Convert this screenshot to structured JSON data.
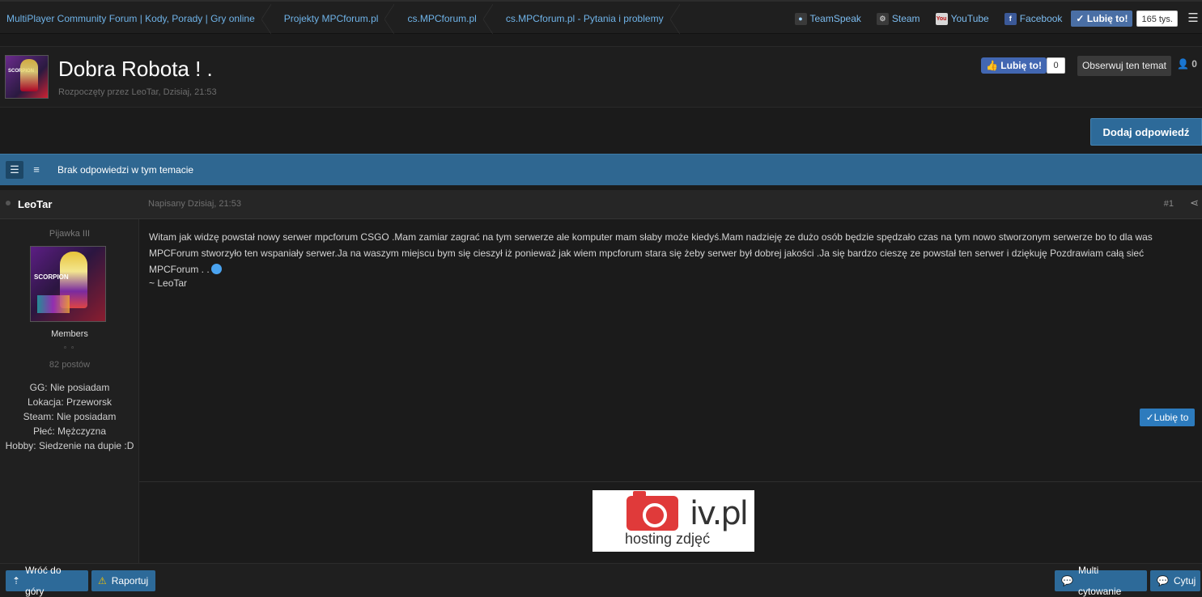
{
  "breadcrumb": [
    "MultiPlayer Community Forum | Kody, Porady | Gry online",
    "Projekty MPCforum.pl",
    "cs.MPCforum.pl",
    "cs.MPCforum.pl - Pytania i problemy"
  ],
  "social": {
    "teamspeak": "TeamSpeak",
    "steam": "Steam",
    "youtube": "YouTube",
    "facebook": "Facebook",
    "like_label": "Lubię to!",
    "like_count": "165 tys.",
    "icons": [
      "teamspeak-icon",
      "steam-icon",
      "youtube-icon",
      "facebook-icon",
      "menu-icon"
    ]
  },
  "topic": {
    "title": "Dobra Robota ! .",
    "meta": "Rozpoczęty przez LeoTar, Dzisiaj, 21:53",
    "fb_like": "Lubię to!",
    "fb_count": "0",
    "follow": "Obserwuj ten temat",
    "followers": "0"
  },
  "reply_button": "Dodaj odpowiedź",
  "infobar": {
    "text": "Brak odpowiedzi w tym temacie"
  },
  "post": {
    "author": "LeoTar",
    "date": "Napisany Dzisiaj, 21:53",
    "number": "#1",
    "rank": "Pijawka III",
    "avatar_text": "SCORPION",
    "group": "Members",
    "pips": "▫ ▫",
    "posts_count": "82 postów",
    "fields": [
      "GG: Nie posiadam",
      "Lokacja: Przeworsk",
      "Steam: Nie posiadam",
      "Płeć: Mężczyzna",
      "Hobby: Siedzenie na dupie :D"
    ],
    "body": "Witam jak widzę powstał nowy serwer mpcforum CSGO .Mam zamiar zagrać na tym serwerze ale komputer mam słaby może kiedyś.Mam nadzieję ze dużo osób będzie spędzało czas na tym nowo stworzonym serwerze bo to dla was MPCForum stworzyło ten wspaniały serwer.Ja na waszym miejscu bym się cieszył iż ponieważ jak wiem mpcforum stara się żeby serwer był dobrej jakości .Ja się bardzo cieszę ze powstał ten serwer i dziękuję Pozdrawiam całą sieć MPCForum . .",
    "signature": "~ LeoTar",
    "like_button": "✓Lubię to",
    "banner": {
      "brand": "iv.pl",
      "sub": "hosting zdjęć"
    }
  },
  "bottom": {
    "back_top": "Wróć do góry",
    "report": "Raportuj",
    "multiquote": "Multi cytowanie",
    "quote": "Cytuj"
  },
  "colors": {
    "accent": "#2d6a99",
    "link": "#6fb3e8",
    "infobar": "#2f6791"
  }
}
